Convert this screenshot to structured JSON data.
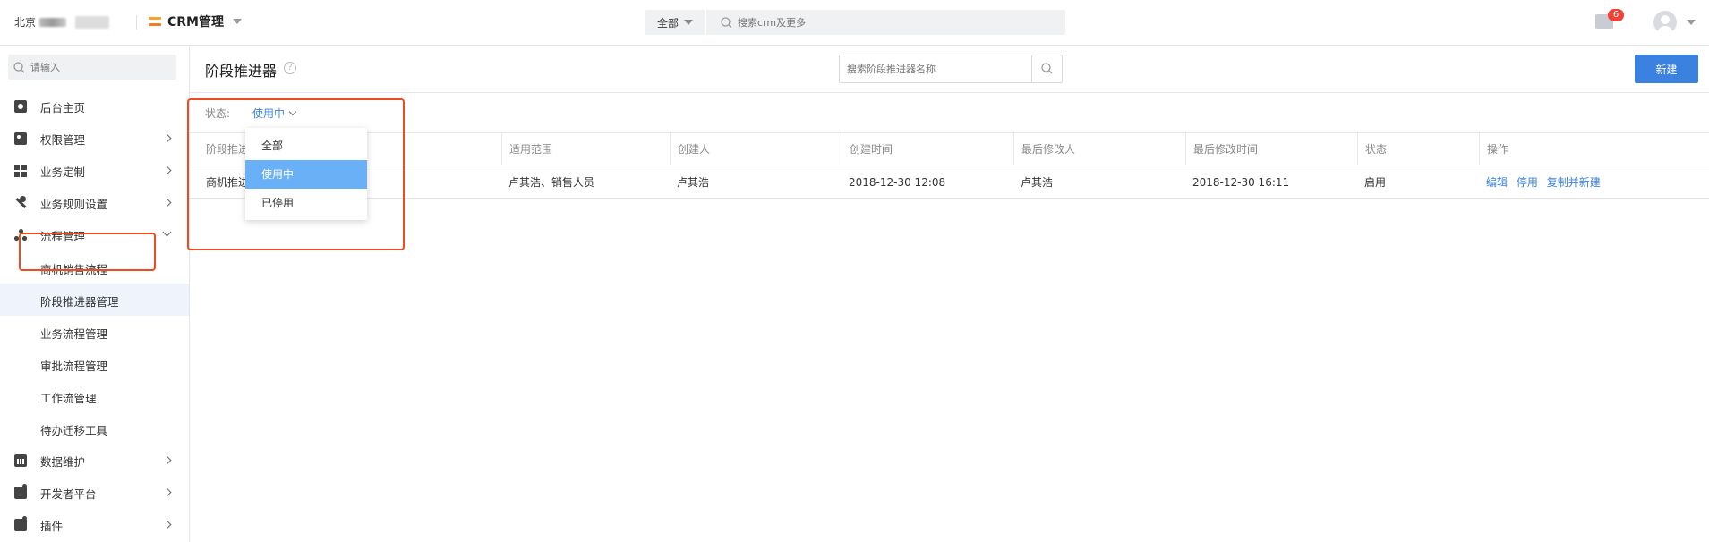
{
  "topbar": {
    "company_prefix": "北京",
    "app_title": "CRM管理",
    "search_scope": "全部",
    "search_placeholder": "搜索crm及更多",
    "message_count": "6"
  },
  "sidebar": {
    "search_placeholder": "请输入",
    "items": [
      {
        "label": "后台主页",
        "icon": "home-icon"
      },
      {
        "label": "权限管理",
        "icon": "id-card-icon"
      },
      {
        "label": "业务定制",
        "icon": "grid-icon"
      },
      {
        "label": "业务规则设置",
        "icon": "wrench-icon"
      },
      {
        "label": "流程管理",
        "icon": "flow-icon"
      },
      {
        "label": "数据维护",
        "icon": "chart-icon"
      },
      {
        "label": "开发者平台",
        "icon": "puzzle-icon"
      },
      {
        "label": "插件",
        "icon": "puzzle-icon"
      }
    ],
    "sub_items": [
      "商机销售流程",
      "阶段推进器管理",
      "业务流程管理",
      "审批流程管理",
      "工作流管理",
      "待办迁移工具"
    ]
  },
  "main": {
    "title": "阶段推进器",
    "search_placeholder": "搜索阶段推进器名称",
    "new_button": "新建",
    "filter": {
      "label": "状态:",
      "value": "使用中",
      "options": [
        "全部",
        "使用中",
        "已停用"
      ]
    },
    "table": {
      "headers": [
        "阶段推进",
        "适用范围",
        "创建人",
        "创建时间",
        "最后修改人",
        "最后修改时间",
        "状态",
        "操作"
      ],
      "rows": [
        {
          "name": "商机推进",
          "scope": "卢其浩、销售人员",
          "creator": "卢其浩",
          "created_at": "2018-12-30 12:08",
          "modifier": "卢其浩",
          "modified_at": "2018-12-30 16:11",
          "status": "启用",
          "actions": [
            "编辑",
            "停用",
            "复制并新建"
          ]
        }
      ]
    }
  }
}
